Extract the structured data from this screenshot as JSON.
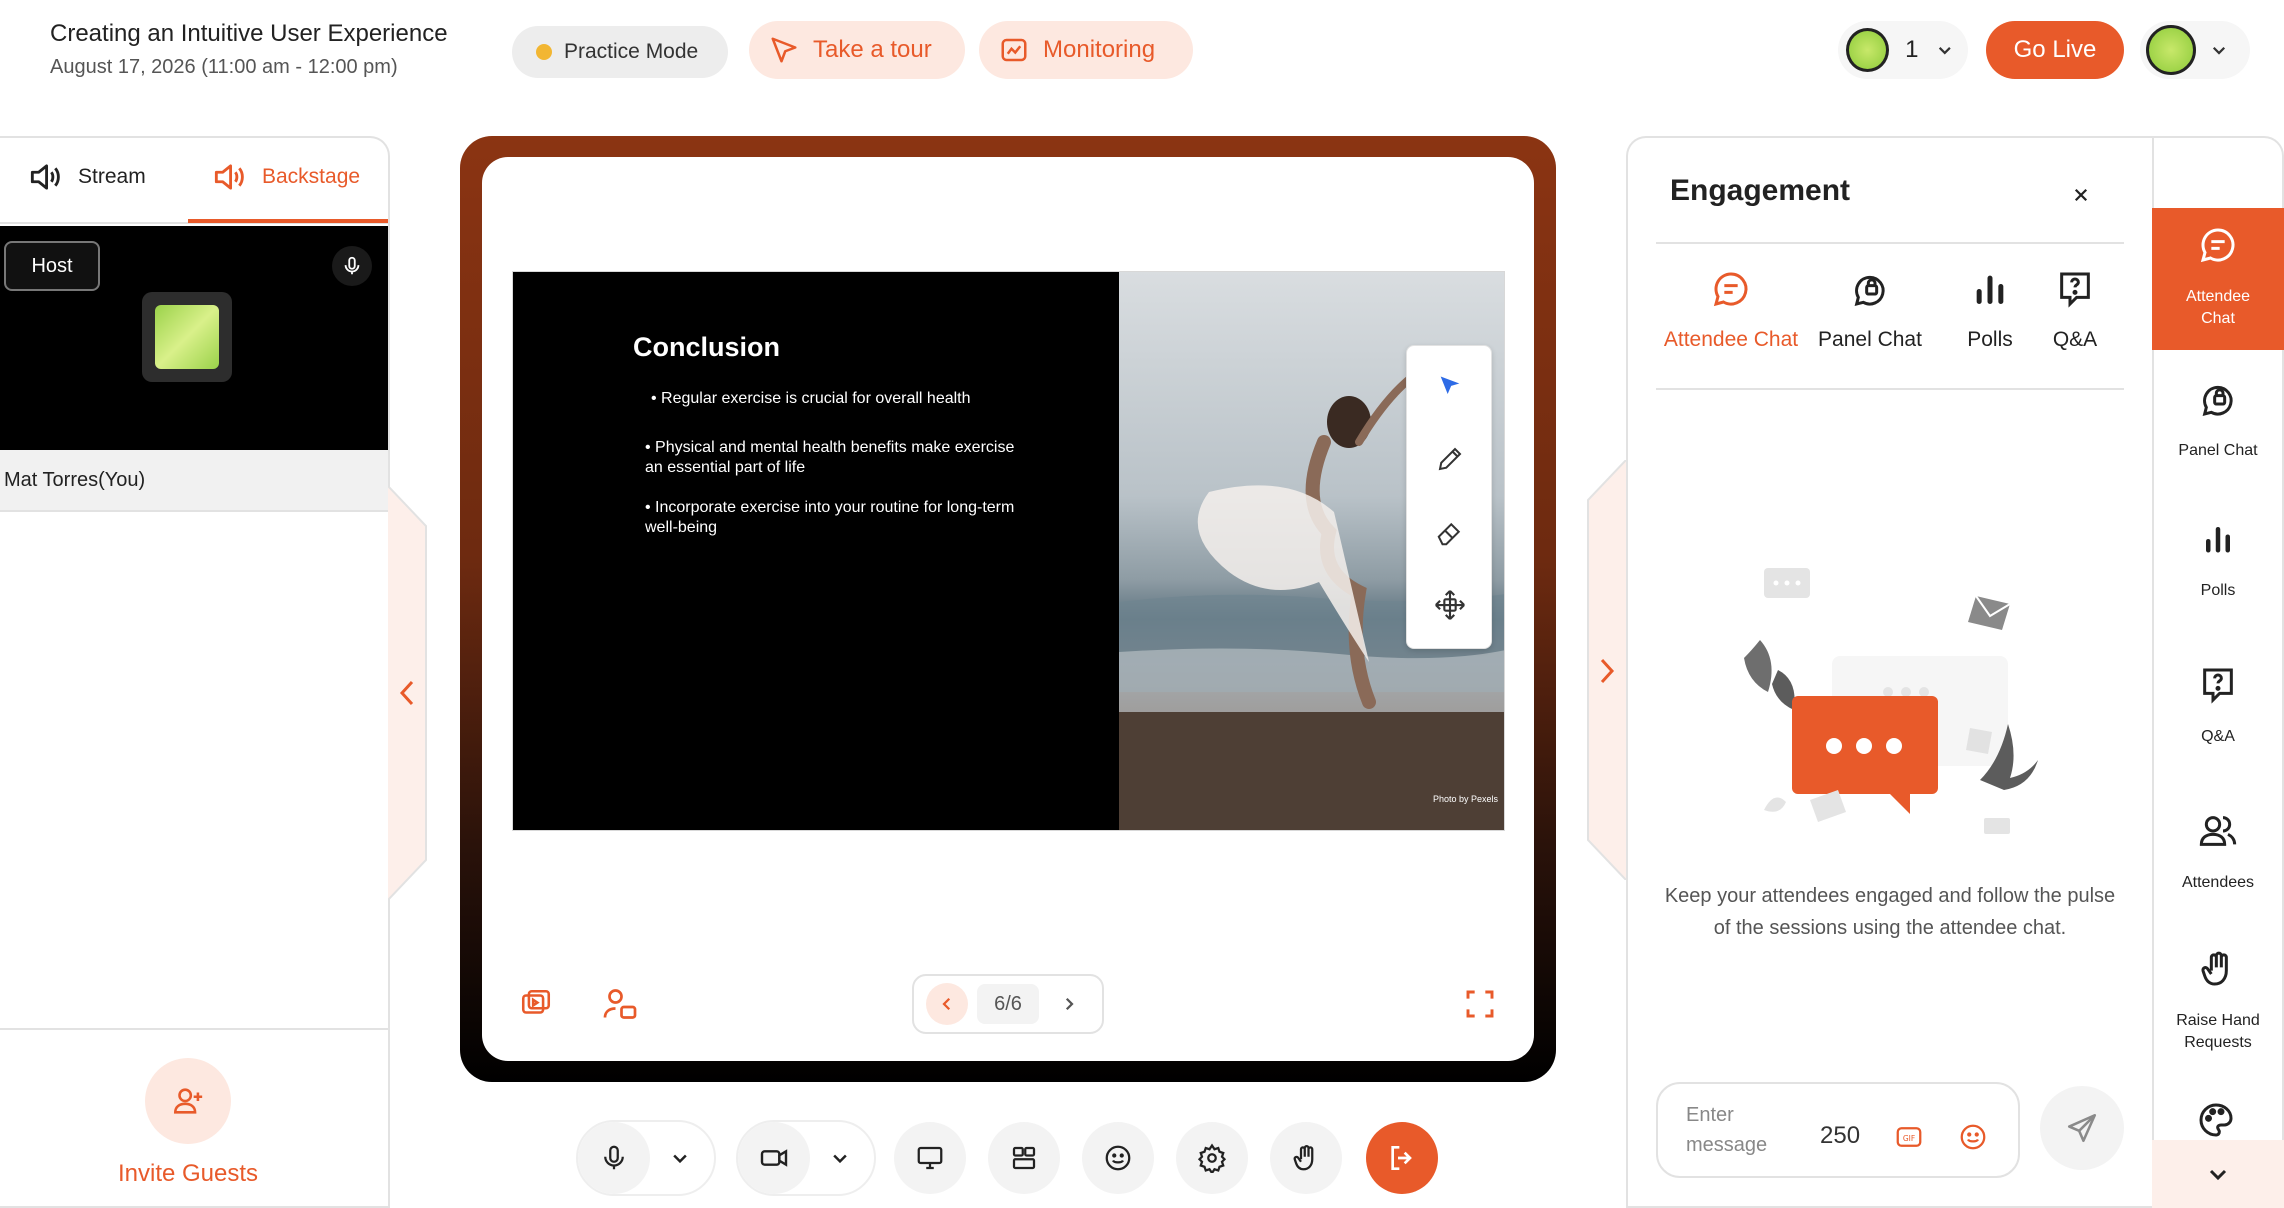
{
  "header": {
    "title": "Creating an Intuitive User Experience",
    "subtitle": "August 17, 2026 (11:00 am - 12:00 pm)",
    "practice_mode": "Practice Mode",
    "take_tour": "Take a tour",
    "monitoring": "Monitoring",
    "viewer_count": "1",
    "go_live": "Go Live"
  },
  "left_panel": {
    "tabs": [
      {
        "label": "Stream"
      },
      {
        "label": "Backstage"
      }
    ],
    "host_badge": "Host",
    "participant_name": "Mat Torres(You)",
    "invite_label": "Invite Guests"
  },
  "slide": {
    "title": "Conclusion",
    "bullets": [
      "• Regular exercise is crucial for overall health",
      "• Physical and mental health benefits make exercise an essential part of life",
      "• Incorporate exercise into your routine for long-term well-being"
    ],
    "photo_credit": "Photo by Pexels"
  },
  "pager": {
    "page": "6/6"
  },
  "engagement": {
    "title": "Engagement",
    "tabs": [
      {
        "label": "Attendee Chat"
      },
      {
        "label": "Panel Chat"
      },
      {
        "label": "Polls"
      },
      {
        "label": "Q&A"
      }
    ],
    "empty_text": "Keep your attendees engaged and follow the pulse of the sessions using the attendee chat.",
    "message_placeholder": "Enter message",
    "char_count": "250"
  },
  "rail": {
    "items": [
      {
        "label": "Attendee Chat"
      },
      {
        "label": "Panel Chat"
      },
      {
        "label": "Polls"
      },
      {
        "label": "Q&A"
      },
      {
        "label": "Attendees"
      },
      {
        "label": "Raise Hand Requests"
      }
    ]
  },
  "colors": {
    "accent": "#E85A2A",
    "accent_light": "#FDE8E0",
    "practice_dot": "#F2B632"
  },
  "icons": [
    "speaker-icon",
    "mic-icon",
    "camera-icon",
    "screen-share-icon",
    "layout-icon",
    "emoji-icon",
    "settings-icon",
    "hand-icon",
    "leave-icon",
    "chat-icon",
    "panel-chat-icon",
    "polls-icon",
    "qa-icon",
    "attendees-icon",
    "palette-icon",
    "send-icon",
    "gif-icon",
    "fullscreen-icon",
    "pointer-icon",
    "pencil-icon",
    "eraser-icon",
    "move-icon"
  ]
}
